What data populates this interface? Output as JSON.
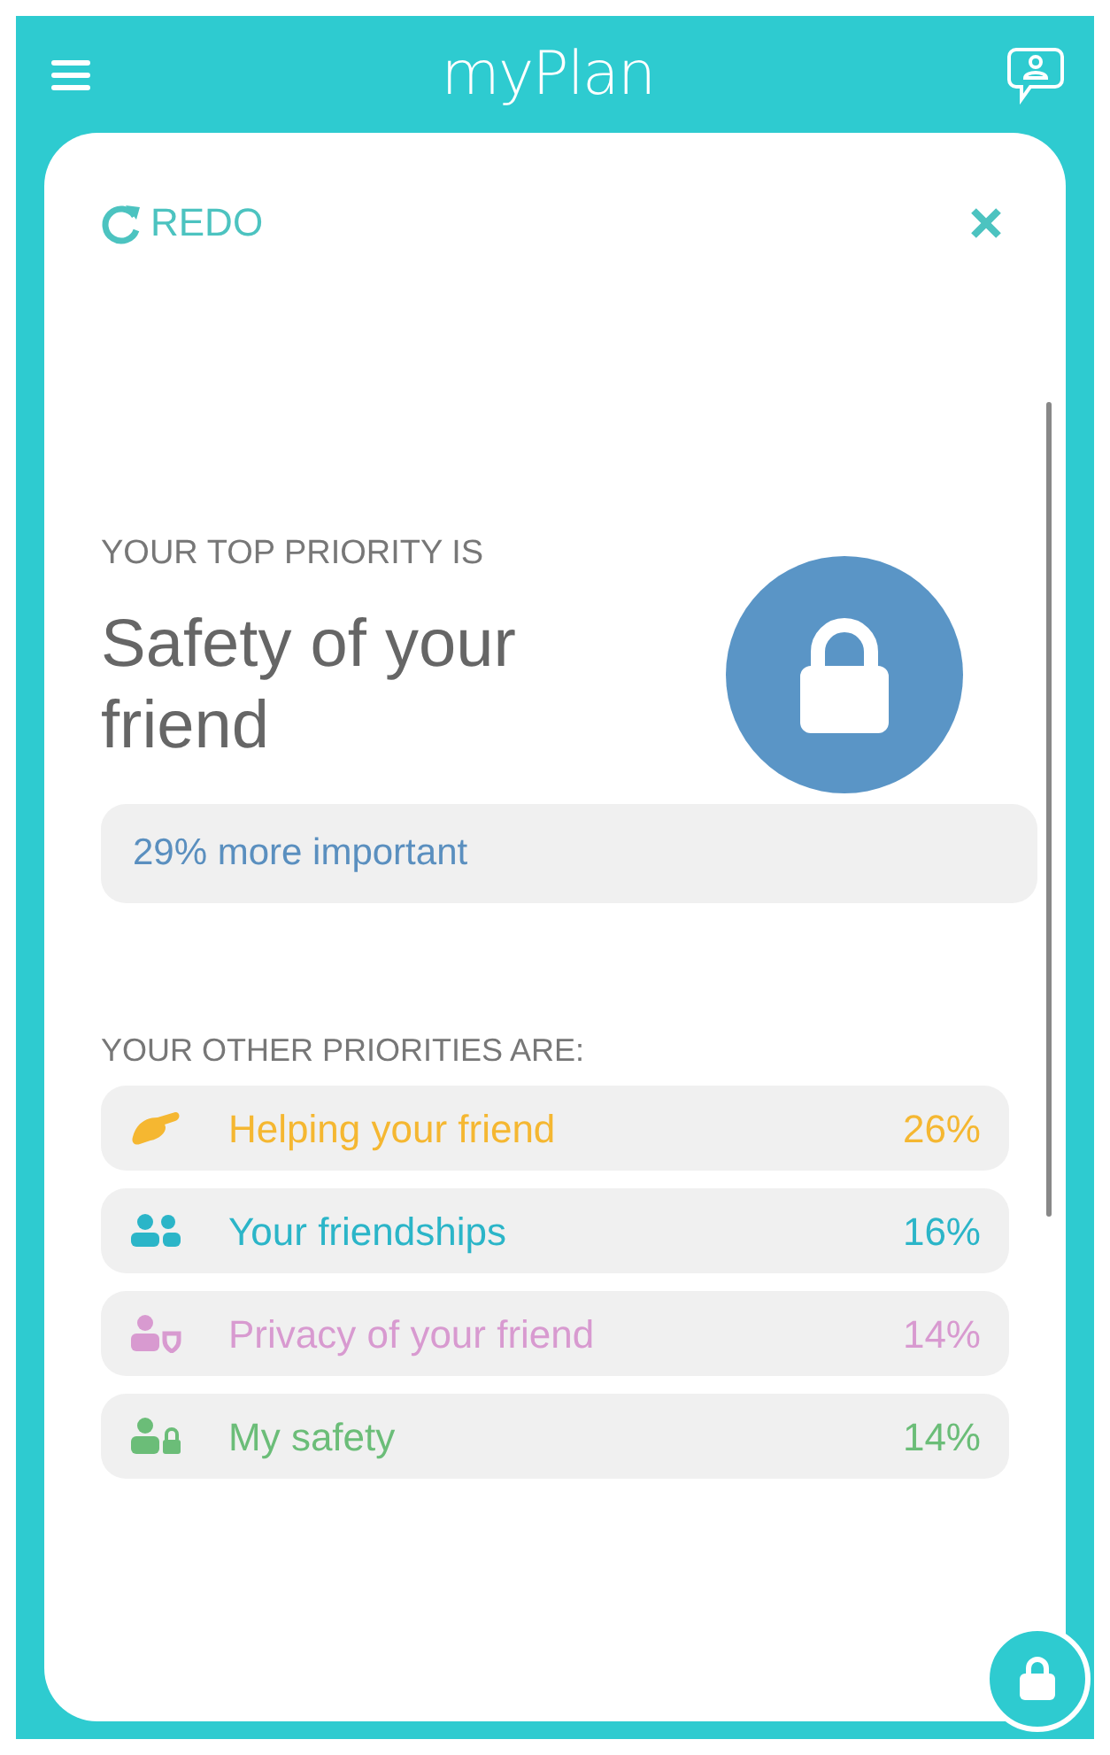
{
  "header": {
    "logo": "myPlan"
  },
  "toolbar": {
    "redo": "REDO"
  },
  "top_priority": {
    "label": "YOUR TOP PRIORITY IS",
    "title": "Safety of your friend",
    "note": "29% more important"
  },
  "other_priorities": {
    "label": "YOUR OTHER PRIORITIES ARE:",
    "items": [
      {
        "kind": "helping",
        "label": "Helping your friend",
        "percent": "26%",
        "color": "#f5b731"
      },
      {
        "kind": "friendships",
        "label": "Your friendships",
        "percent": "16%",
        "color": "#2bb5c8"
      },
      {
        "kind": "privacy",
        "label": "Privacy of your friend",
        "percent": "14%",
        "color": "#d89ad0"
      },
      {
        "kind": "safety",
        "label": "My safety",
        "percent": "14%",
        "color": "#6bbd78"
      }
    ]
  }
}
